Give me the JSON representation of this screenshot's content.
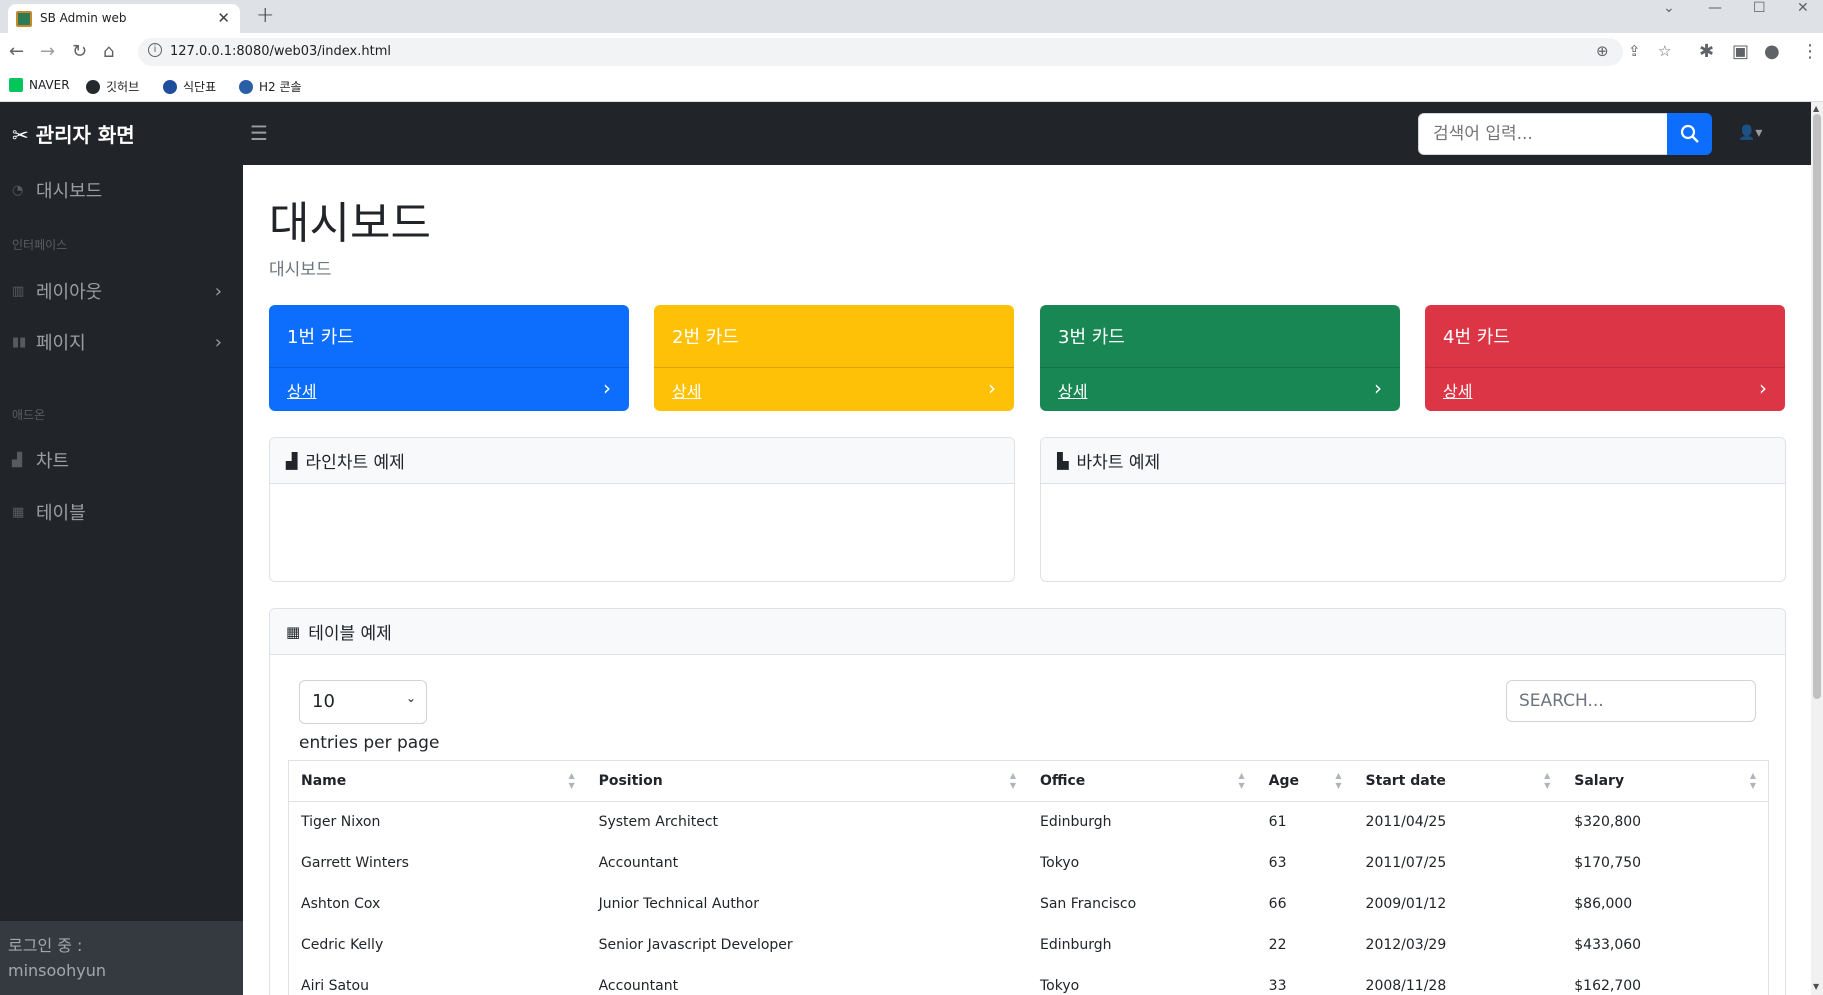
{
  "browser": {
    "tab_title": "SB Admin web",
    "url": "127.0.0.1:8080/web03/index.html",
    "bookmarks": [
      {
        "label": "NAVER",
        "color": "#03c75a"
      },
      {
        "label": "깃허브",
        "color": "#24292e"
      },
      {
        "label": "식단표",
        "color": "#1f4e9c"
      },
      {
        "label": "H2 콘솔",
        "color": "#2a5fa8"
      }
    ]
  },
  "topnav": {
    "brand": "관리자 화면",
    "search_placeholder": "검색어 입력..."
  },
  "sidenav": {
    "items": [
      {
        "label": "대시보드",
        "icon": "tachometer-icon"
      },
      {
        "heading": "인터페이스"
      },
      {
        "label": "레이아웃",
        "icon": "columns-icon",
        "has_arrow": true
      },
      {
        "label": "페이지",
        "icon": "book-icon",
        "has_arrow": true
      },
      {
        "heading": "애드온"
      },
      {
        "label": "차트",
        "icon": "chart-area-icon"
      },
      {
        "label": "테이블",
        "icon": "table-icon"
      }
    ],
    "footer_label": "로그인 중 :",
    "footer_user": "minsoohyun"
  },
  "main": {
    "title": "대시보드",
    "breadcrumb": "대시보드",
    "cards": [
      {
        "title": "1번 카드",
        "link": "상세",
        "color": "#0d6efd"
      },
      {
        "title": "2번 카드",
        "link": "상세",
        "color": "#ffc107"
      },
      {
        "title": "3번 카드",
        "link": "상세",
        "color": "#198754"
      },
      {
        "title": "4번 카드",
        "link": "상세",
        "color": "#dc3545"
      }
    ],
    "line_chart_title": "라인차트 예제",
    "bar_chart_title": "바차트 예제",
    "table_title": "테이블 예제",
    "table": {
      "entries_value": "10",
      "entries_label": "entries per page",
      "search_placeholder": "SEARCH...",
      "columns": [
        "Name",
        "Position",
        "Office",
        "Age",
        "Start date",
        "Salary"
      ],
      "rows": [
        [
          "Tiger Nixon",
          "System Architect",
          "Edinburgh",
          "61",
          "2011/04/25",
          "$320,800"
        ],
        [
          "Garrett Winters",
          "Accountant",
          "Tokyo",
          "63",
          "2011/07/25",
          "$170,750"
        ],
        [
          "Ashton Cox",
          "Junior Technical Author",
          "San Francisco",
          "66",
          "2009/01/12",
          "$86,000"
        ],
        [
          "Cedric Kelly",
          "Senior Javascript Developer",
          "Edinburgh",
          "22",
          "2012/03/29",
          "$433,060"
        ],
        [
          "Airi Satou",
          "Accountant",
          "Tokyo",
          "33",
          "2008/11/28",
          "$162,700"
        ]
      ]
    }
  }
}
